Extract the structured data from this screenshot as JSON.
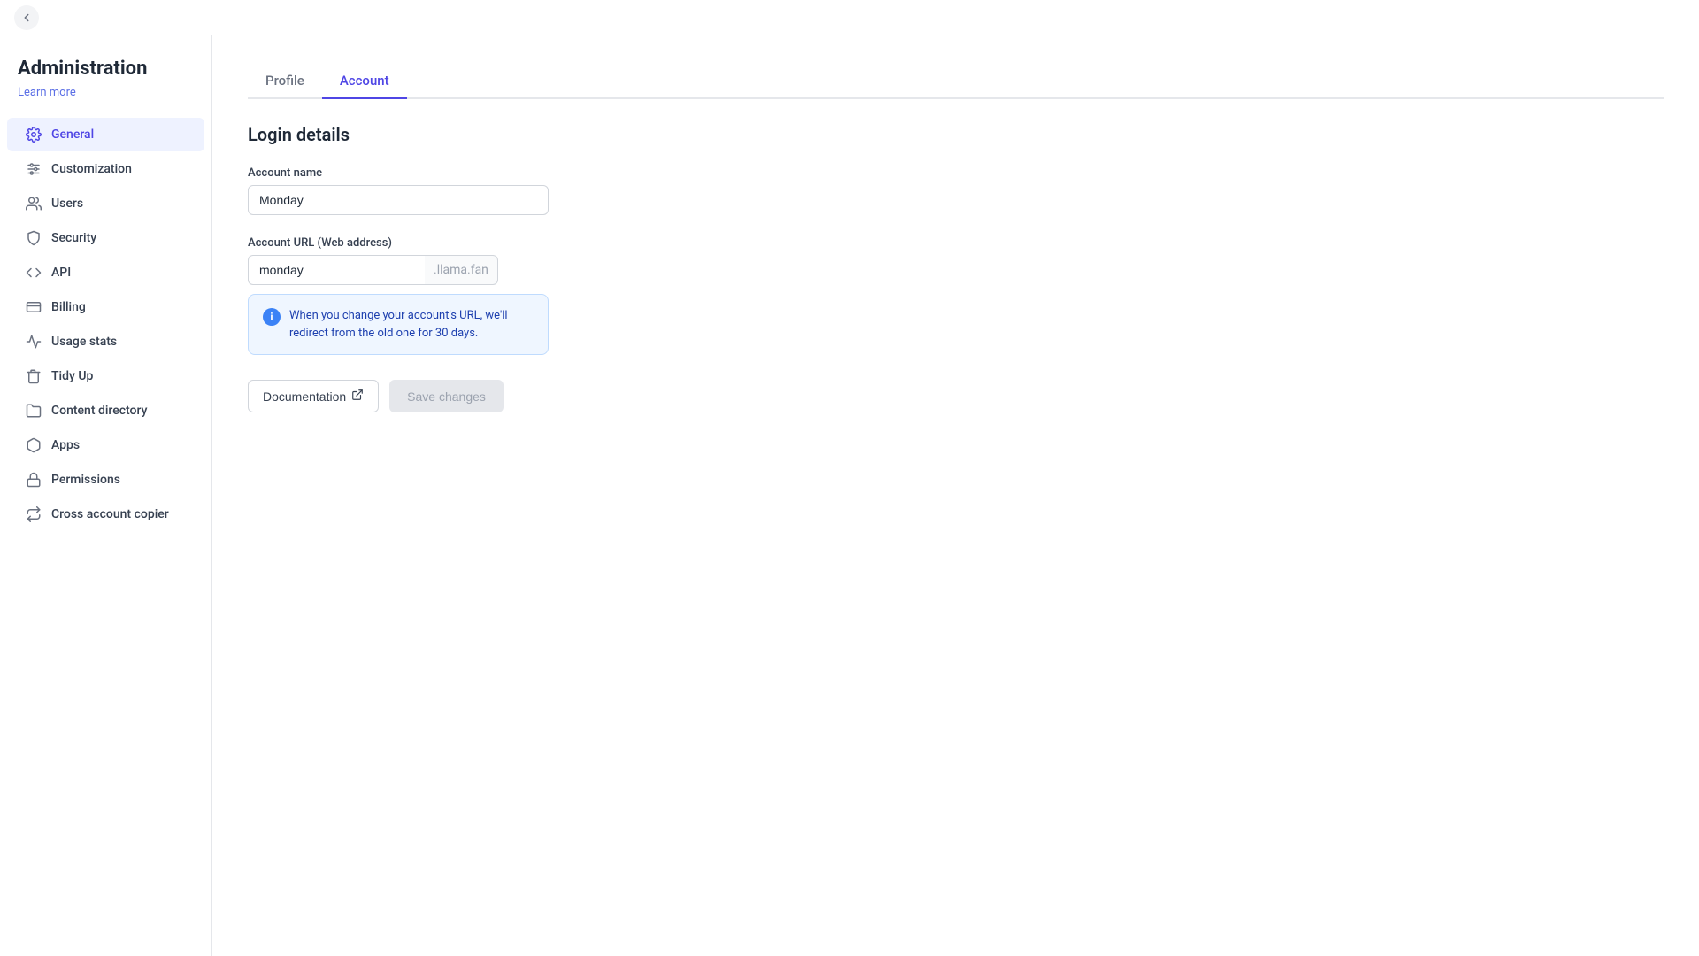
{
  "topbar": {
    "back_label": "←"
  },
  "sidebar": {
    "title": "Administration",
    "learn_more_label": "Learn more",
    "items": [
      {
        "id": "general",
        "label": "General",
        "active": true,
        "icon": "gear"
      },
      {
        "id": "customization",
        "label": "Customization",
        "active": false,
        "icon": "sliders"
      },
      {
        "id": "users",
        "label": "Users",
        "active": false,
        "icon": "users"
      },
      {
        "id": "security",
        "label": "Security",
        "active": false,
        "icon": "shield"
      },
      {
        "id": "api",
        "label": "API",
        "active": false,
        "icon": "api"
      },
      {
        "id": "billing",
        "label": "Billing",
        "active": false,
        "icon": "billing"
      },
      {
        "id": "usage-stats",
        "label": "Usage stats",
        "active": false,
        "icon": "chart"
      },
      {
        "id": "tidy-up",
        "label": "Tidy Up",
        "active": false,
        "icon": "tidy"
      },
      {
        "id": "content-directory",
        "label": "Content directory",
        "active": false,
        "icon": "directory"
      },
      {
        "id": "apps",
        "label": "Apps",
        "active": false,
        "icon": "apps"
      },
      {
        "id": "permissions",
        "label": "Permissions",
        "active": false,
        "icon": "lock"
      },
      {
        "id": "cross-account-copier",
        "label": "Cross account copier",
        "active": false,
        "icon": "copy"
      }
    ]
  },
  "content": {
    "tabs": [
      {
        "id": "profile",
        "label": "Profile",
        "active": false
      },
      {
        "id": "account",
        "label": "Account",
        "active": true
      }
    ],
    "section_title": "Login details",
    "account_name_label": "Account name",
    "account_name_value": "Monday",
    "account_url_label": "Account URL (Web address)",
    "account_url_value": "monday",
    "account_url_suffix": ".llama.fan",
    "info_text": "When you change your account's URL, we'll redirect from the old one for 30 days.",
    "doc_button_label": "Documentation",
    "save_button_label": "Save changes"
  }
}
